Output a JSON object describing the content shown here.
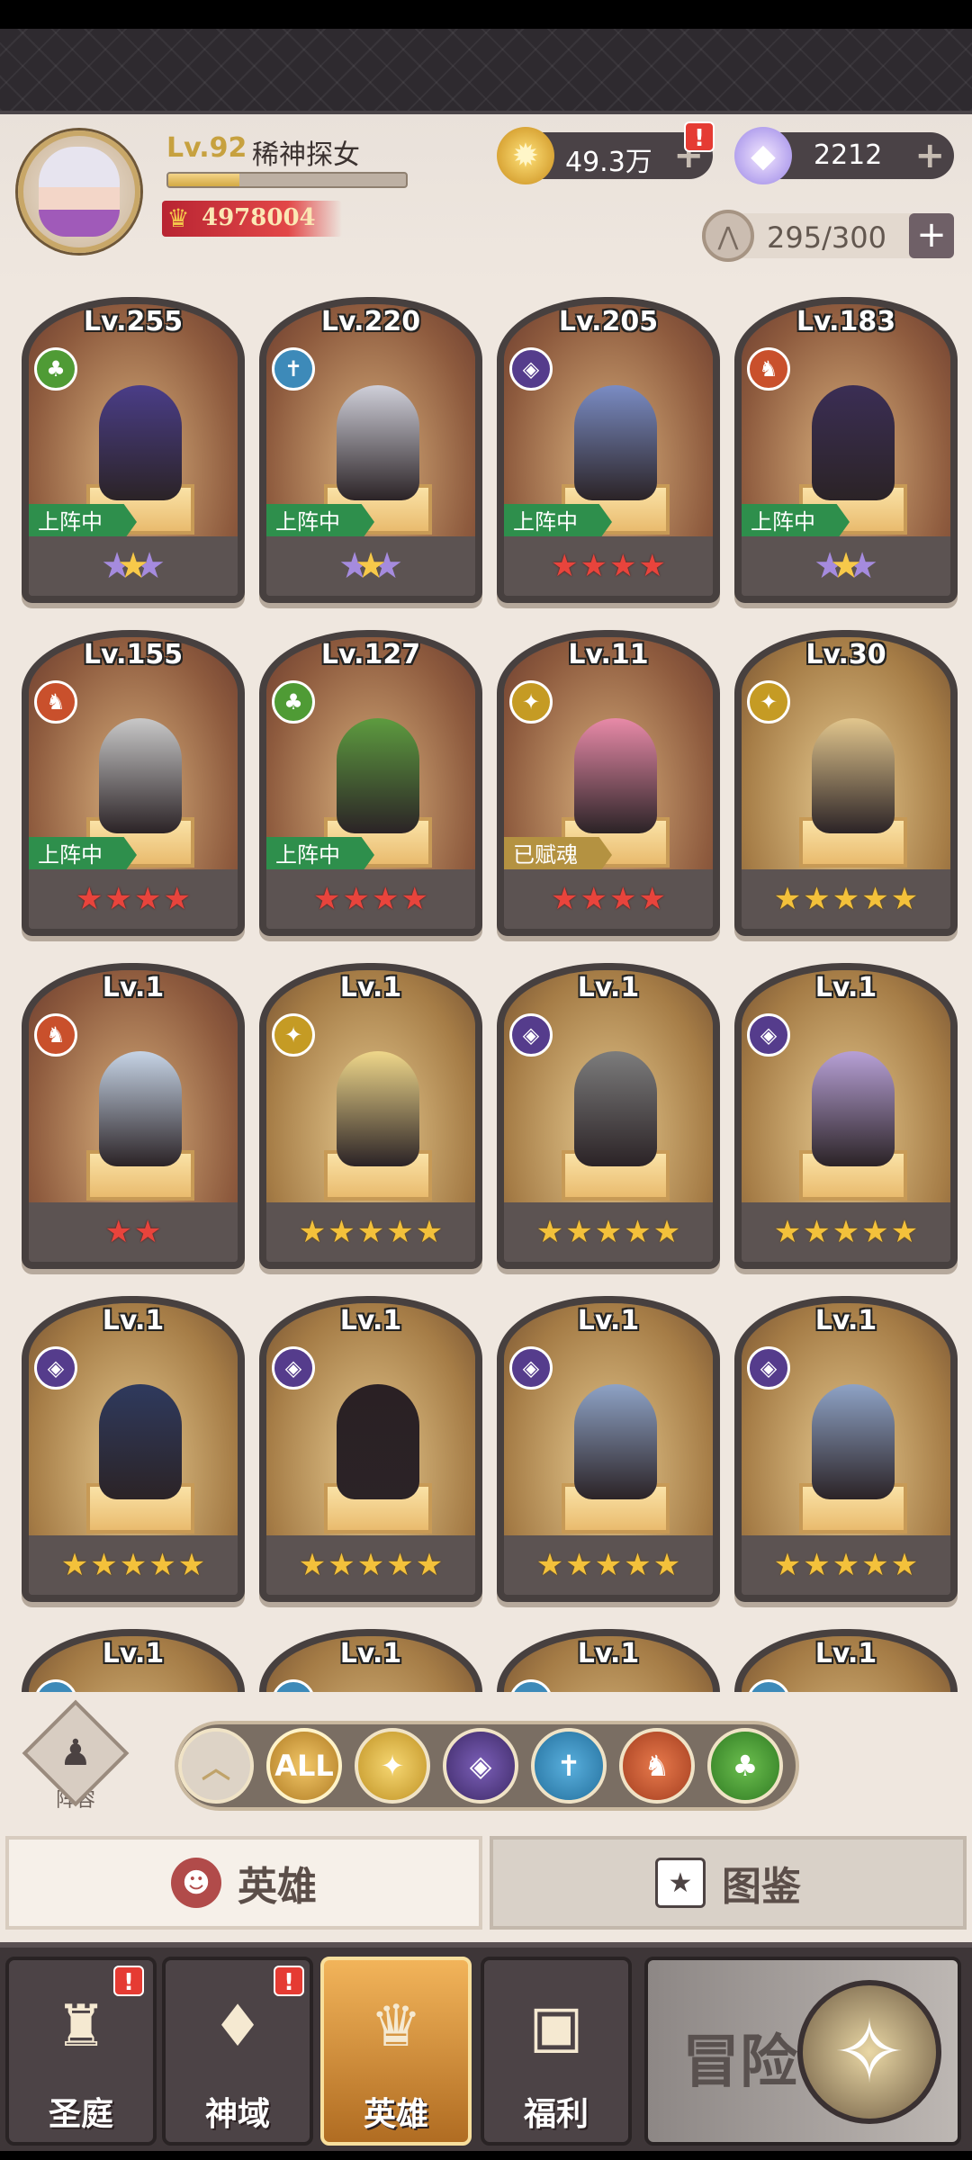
{
  "header": {
    "level": "Lv.92",
    "name": "稀神探女",
    "exp_fraction": 0.3,
    "power": "4978004",
    "gold": "49.3万",
    "gems": "2212",
    "gold_alert": "!",
    "slots": "295/300",
    "plus": "+"
  },
  "heroes": [
    {
      "level": "Lv.255",
      "faction": "nature",
      "status": "上阵中",
      "stars": "★",
      "star_style": "purple-wing"
    },
    {
      "level": "Lv.220",
      "faction": "holy",
      "status": "上阵中",
      "stars": "★",
      "star_style": "purple-wing"
    },
    {
      "level": "Lv.205",
      "faction": "dark",
      "status": "上阵中",
      "stars": "★★★★",
      "star_style": "red"
    },
    {
      "level": "Lv.183",
      "faction": "fire",
      "status": "上阵中",
      "stars": "★",
      "star_style": "purple-wing"
    },
    {
      "level": "Lv.155",
      "faction": "fire",
      "status": "上阵中",
      "stars": "★★★★",
      "star_style": "red"
    },
    {
      "level": "Lv.127",
      "faction": "nature",
      "status": "上阵中",
      "stars": "★★★★",
      "star_style": "red"
    },
    {
      "level": "Lv.11",
      "faction": "light",
      "status": "已赋魂",
      "stars": "★★★★",
      "star_style": "red"
    },
    {
      "level": "Lv.30",
      "faction": "light",
      "status": "",
      "stars": "★★★★★",
      "star_style": "gold"
    },
    {
      "level": "Lv.1",
      "faction": "fire",
      "status": "",
      "stars": "★★",
      "star_style": "red"
    },
    {
      "level": "Lv.1",
      "faction": "light",
      "status": "",
      "stars": "★★★★★",
      "star_style": "gold"
    },
    {
      "level": "Lv.1",
      "faction": "dark",
      "status": "",
      "stars": "★★★★★",
      "star_style": "gold"
    },
    {
      "level": "Lv.1",
      "faction": "dark",
      "status": "",
      "stars": "★★★★★",
      "star_style": "gold"
    },
    {
      "level": "Lv.1",
      "faction": "dark",
      "status": "",
      "stars": "★★★★★",
      "star_style": "gold"
    },
    {
      "level": "Lv.1",
      "faction": "dark",
      "status": "",
      "stars": "★★★★★",
      "star_style": "gold"
    },
    {
      "level": "Lv.1",
      "faction": "dark",
      "status": "",
      "stars": "★★★★★",
      "star_style": "gold"
    },
    {
      "level": "Lv.1",
      "faction": "dark",
      "status": "",
      "stars": "★★★★★",
      "star_style": "gold"
    },
    {
      "level": "Lv.1",
      "faction": "holy",
      "status": "",
      "stars": "",
      "star_style": "gold"
    },
    {
      "level": "Lv.1",
      "faction": "holy",
      "status": "",
      "stars": "",
      "star_style": "gold"
    },
    {
      "level": "Lv.1",
      "faction": "holy",
      "status": "",
      "stars": "",
      "star_style": "gold"
    },
    {
      "level": "Lv.1",
      "faction": "holy",
      "status": "",
      "stars": "",
      "star_style": "gold"
    }
  ],
  "lineup": {
    "label": "阵容"
  },
  "filters": {
    "all_label": "ALL"
  },
  "tabs": {
    "heroes": "英雄",
    "codex": "图鉴"
  },
  "nav": {
    "courtyard": "圣庭",
    "divine": "神域",
    "heroes": "英雄",
    "welfare": "福利",
    "adventure": "冒险",
    "alert": "!"
  }
}
